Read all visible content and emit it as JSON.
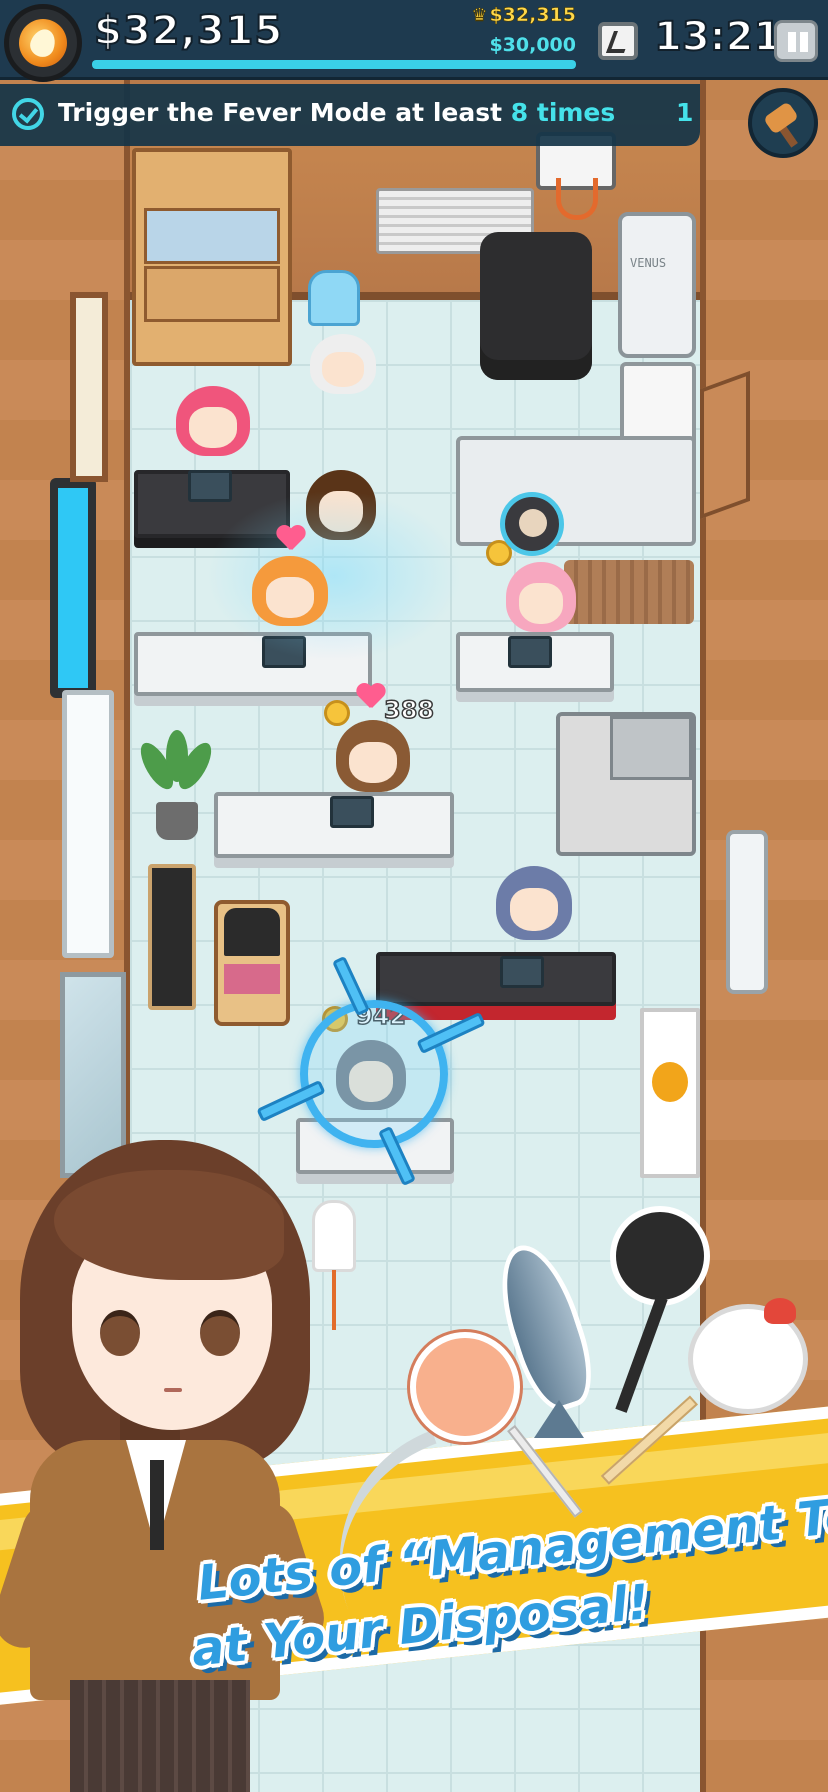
{
  "hud": {
    "fever_icon": "fever-flame-icon",
    "money": "$32,315",
    "money_progress": 1.0,
    "record_money": "$32,315",
    "target_money": "$30,000",
    "crown_icon": "crown-icon",
    "clock_icon": "office-clock-icon",
    "time": "13:21",
    "pause_icon": "pause-icon"
  },
  "mission": {
    "icon": "checkmark-timer-icon",
    "text_prefix": "Trigger the Fever Mode at least ",
    "text_highlight": "8 times",
    "count": "1"
  },
  "tool_button": {
    "icon": "hammer-icon"
  },
  "scene": {
    "fridge_label": "VENUS",
    "popup_1": "388",
    "popup_2": "942"
  },
  "promo": {
    "line1": "Lots of “Management Tools”",
    "line2": "at Your Disposal!"
  },
  "colors": {
    "hud_bg": "#1e3a4f",
    "accent_cyan": "#45e2ea",
    "gold": "#ffd84a",
    "promo_blue": "#2f9de0",
    "ribbon_yellow": "#f6c11f"
  }
}
